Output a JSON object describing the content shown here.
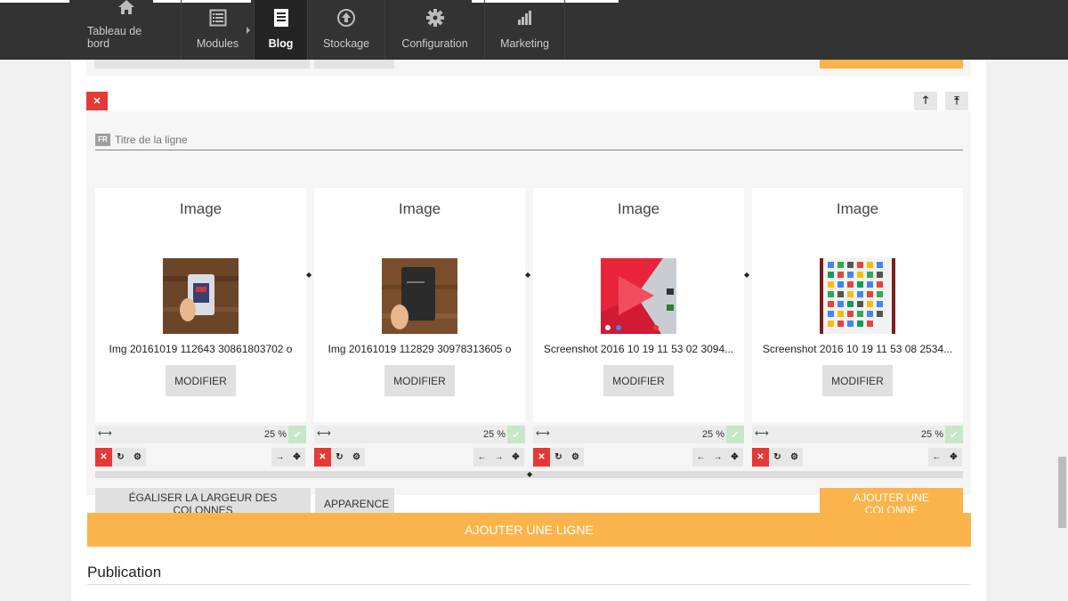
{
  "nav": {
    "items": [
      {
        "label": "Tableau de bord",
        "icon": "home-icon"
      },
      {
        "label": "Modules",
        "icon": "list-icon"
      },
      {
        "label": "Blog",
        "icon": "document-icon"
      },
      {
        "label": "Stockage",
        "icon": "upload-circle-icon"
      },
      {
        "label": "Configuration",
        "icon": "gear-icon"
      },
      {
        "label": "Marketing",
        "icon": "bar-chart-icon"
      }
    ],
    "active": "Blog"
  },
  "row": {
    "title_placeholder": "Titre de la ligne",
    "lang_flag": "FR",
    "columns": [
      {
        "heading": "Image",
        "filename": "Img 20161019 112643 30861803702 o",
        "button": "MODIFIER",
        "width": "25 %"
      },
      {
        "heading": "Image",
        "filename": "Img 20161019 112829 30978313605 o",
        "button": "MODIFIER",
        "width": "25 %"
      },
      {
        "heading": "Image",
        "filename": "Screenshot 2016 10 19 11 53 02 3094...",
        "button": "MODIFIER",
        "width": "25 %"
      },
      {
        "heading": "Image",
        "filename": "Screenshot 2016 10 19 11 53 08 2534...",
        "button": "MODIFIER",
        "width": "25 %"
      }
    ],
    "buttons": {
      "equalize": "ÉGALISER LA LARGEUR DES COLONNES",
      "appearance": "APPARENCE",
      "add_column": "AJOUTER UNE COLONNE"
    }
  },
  "add_line": "AJOUTER UNE LIGNE",
  "publication_title": "Publication",
  "colors": {
    "accent": "#fbb44b",
    "danger": "#e53935",
    "nav_bg": "#333333"
  }
}
